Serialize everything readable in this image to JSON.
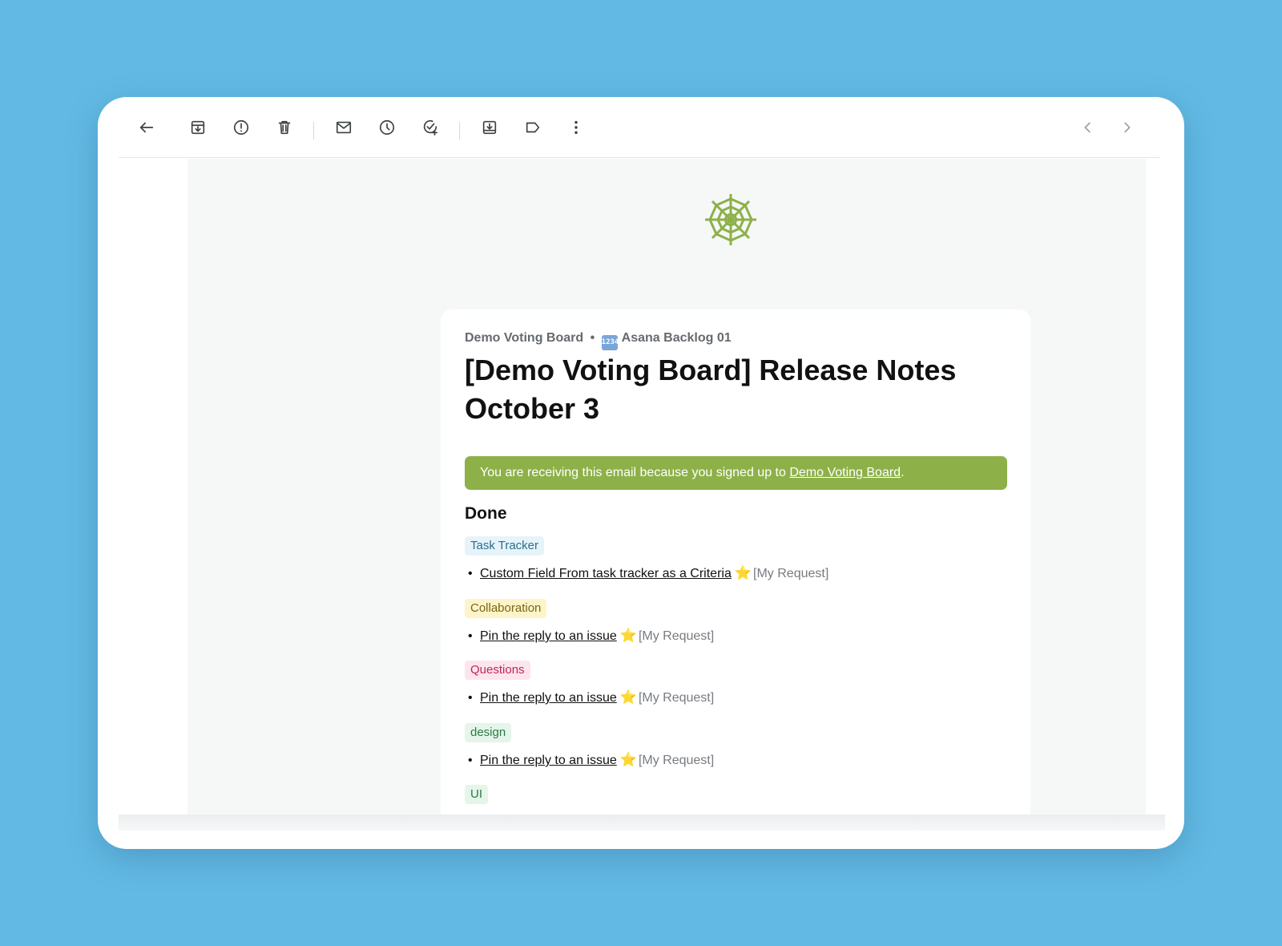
{
  "toolbar": {
    "icons": [
      "back-arrow-icon",
      "archive-icon",
      "report-spam-icon",
      "delete-icon",
      "mark-unread-icon",
      "snooze-icon",
      "add-to-tasks-icon",
      "move-to-icon",
      "label-icon",
      "more-options-icon",
      "previous-icon",
      "next-icon"
    ]
  },
  "email": {
    "breadcrumb": {
      "board": "Demo Voting Board",
      "separator": "•",
      "backlog_icon": "1234",
      "backlog": "Asana Backlog 01"
    },
    "title": "[Demo Voting Board] Release Notes October 3",
    "notice": {
      "text": "You are receiving this email because you signed up to ",
      "link": "Demo Voting Board",
      "suffix": "."
    },
    "section": "Done",
    "groups": [
      {
        "tag": "Task Tracker",
        "item": "Custom Field From task tracker as a Criteria",
        "star": "⭐",
        "request": "[My Request]"
      },
      {
        "tag": "Collaboration",
        "item": "Pin the reply to an issue",
        "star": "⭐",
        "request": "[My Request]"
      },
      {
        "tag": "Questions",
        "item": "Pin the reply to an issue",
        "star": "⭐",
        "request": "[My Request]"
      },
      {
        "tag": "design",
        "item": "Pin the reply to an issue",
        "star": "⭐",
        "request": "[My Request]"
      },
      {
        "tag": "UI"
      }
    ],
    "colors": {
      "accent_green": "#8db148",
      "page_background": "#62bae4"
    }
  }
}
